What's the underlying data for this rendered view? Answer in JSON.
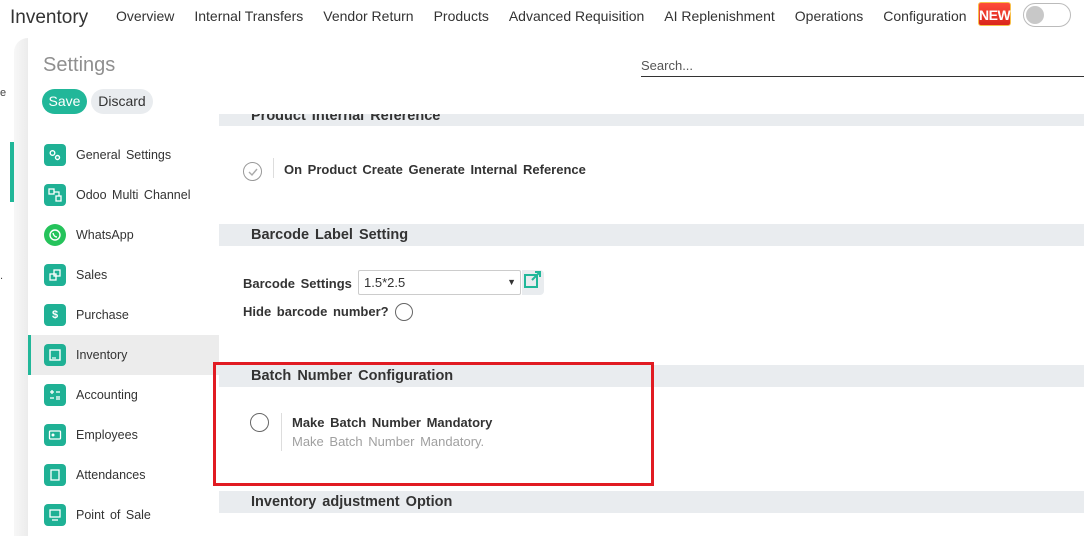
{
  "navbar": {
    "app_name": "Inventory",
    "menu": [
      "Overview",
      "Internal Transfers",
      "Vendor Return",
      "Products",
      "Advanced Requisition",
      "AI Replenishment",
      "Operations",
      "Configuration"
    ],
    "new_badge": "NEW"
  },
  "edge": {
    "char1": "e",
    "char2": "."
  },
  "settings": {
    "title": "Settings",
    "save_label": "Save",
    "discard_label": "Discard"
  },
  "search": {
    "placeholder": "Search..."
  },
  "sidebar": {
    "items": [
      {
        "label": "General Settings",
        "icon": "general-settings-icon"
      },
      {
        "label": "Odoo Multi Channel",
        "icon": "multi-channel-icon"
      },
      {
        "label": "WhatsApp",
        "icon": "whatsapp-icon"
      },
      {
        "label": "Sales",
        "icon": "sales-icon"
      },
      {
        "label": "Purchase",
        "icon": "purchase-icon"
      },
      {
        "label": "Inventory",
        "icon": "inventory-icon",
        "active": true
      },
      {
        "label": "Accounting",
        "icon": "accounting-icon"
      },
      {
        "label": "Employees",
        "icon": "employees-icon"
      },
      {
        "label": "Attendances",
        "icon": "attendances-icon"
      },
      {
        "label": "Point of Sale",
        "icon": "point-of-sale-icon"
      }
    ]
  },
  "content": {
    "section_product_ref": "Product Internal Reference",
    "option_product_ref": "On Product Create Generate Internal Reference",
    "section_barcode": "Barcode Label Setting",
    "barcode_settings_label": "Barcode Settings",
    "barcode_settings_value": "1.5*2.5",
    "hide_barcode_label": "Hide barcode number?",
    "section_batch": "Batch Number Configuration",
    "batch_option_label": "Make Batch Number Mandatory",
    "batch_option_desc": "Make Batch Number Mandatory.",
    "section_adjustment": "Inventory adjustment Option"
  },
  "colors": {
    "accent": "#21b799",
    "highlight": "#e11b22"
  }
}
